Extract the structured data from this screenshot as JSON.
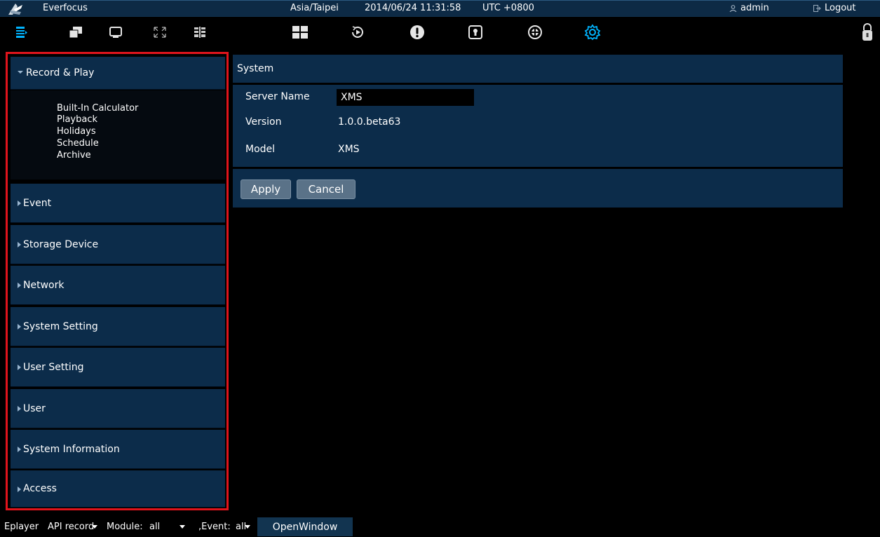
{
  "titlebar": {
    "app_name": "Everfocus",
    "timezone": "Asia/Taipei",
    "datetime": "2014/06/24 11:31:58",
    "utc_offset": "UTC +0800",
    "user": "admin",
    "logout": "Logout"
  },
  "toolbar": {
    "left_icons": [
      "menu-list-icon",
      "windows-icon",
      "monitor-icon",
      "fullscreen-icon",
      "layout-icon"
    ],
    "center_icons": [
      "grid-layout-icon",
      "playback-icon",
      "alert-icon",
      "lock-icon",
      "device-icon",
      "settings-icon"
    ],
    "active_color": "#00b4ff"
  },
  "sidebar": {
    "expanded": {
      "label": "Record & Play",
      "items": [
        "Built-In Calculator",
        "Playback",
        "Holidays",
        "Schedule",
        "Archive"
      ]
    },
    "sections": [
      "Event",
      "Storage Device",
      "Network",
      "System Setting",
      "User Setting",
      "User",
      "System Information",
      "Access"
    ]
  },
  "system": {
    "header": "System",
    "server_name_label": "Server Name",
    "server_name_value": "XMS",
    "version_label": "Version",
    "version_value": "1.0.0.beta63",
    "model_label": "Model",
    "model_value": "XMS",
    "apply": "Apply",
    "cancel": "Cancel"
  },
  "bottombar": {
    "eplayer": "Eplayer",
    "api": "API record",
    "module_label": "Module:",
    "module_value": "all",
    "event_label": ",Event:",
    "event_value": "all",
    "open_window": "OpenWindow"
  }
}
